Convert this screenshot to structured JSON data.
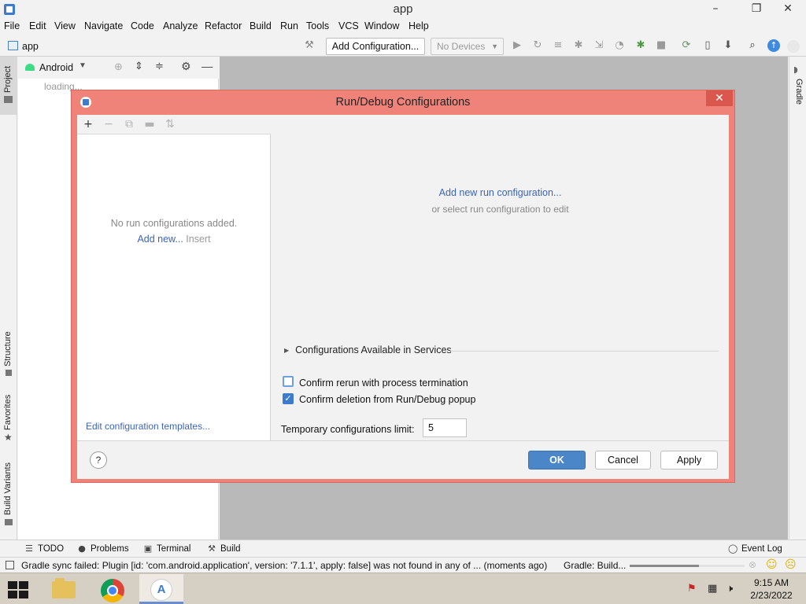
{
  "window": {
    "title": "app",
    "minimize": "–",
    "restore": "❐",
    "close": "✕"
  },
  "menu": [
    "File",
    "Edit",
    "View",
    "Navigate",
    "Code",
    "Analyze",
    "Refactor",
    "Build",
    "Run",
    "Tools",
    "VCS",
    "Window",
    "Help"
  ],
  "toolbar": {
    "project_name": "app",
    "add_configuration": "Add Configuration...",
    "devices": "No Devices"
  },
  "left_tabs": {
    "project": "Project",
    "structure": "Structure",
    "favorites": "Favorites",
    "build_variants": "Build Variants"
  },
  "right_tabs": {
    "gradle": "Gradle"
  },
  "project_panel": {
    "view": "Android",
    "loading": "loading..."
  },
  "dialog": {
    "title": "Run/Debug Configurations",
    "no_configs": "No run configurations added.",
    "add_new": "Add new...",
    "insert_hint": "Insert",
    "edit_templates": "Edit configuration templates...",
    "add_new_run": "Add new run configuration...",
    "or_select": "or select run configuration to edit",
    "services": "Configurations Available in Services",
    "confirm_rerun": {
      "label": "Confirm rerun with process termination",
      "checked": false
    },
    "confirm_deletion": {
      "label": "Confirm deletion from Run/Debug popup",
      "checked": true
    },
    "temp_limit_label": "Temporary configurations limit:",
    "temp_limit_value": "5",
    "help": "?",
    "ok": "OK",
    "cancel": "Cancel",
    "apply": "Apply"
  },
  "bottom_tabs": {
    "todo": "TODO",
    "problems": "Problems",
    "terminal": "Terminal",
    "build": "Build",
    "event_log": "Event Log"
  },
  "status": {
    "message": "Gradle sync failed: Plugin [id: 'com.android.application', version: '7.1.1', apply: false] was not found in any of ... (moments ago)",
    "gradle": "Gradle: Build...",
    "progress": 0.6
  },
  "taskbar": {
    "time": "9:15 AM",
    "date": "2/23/2022"
  }
}
